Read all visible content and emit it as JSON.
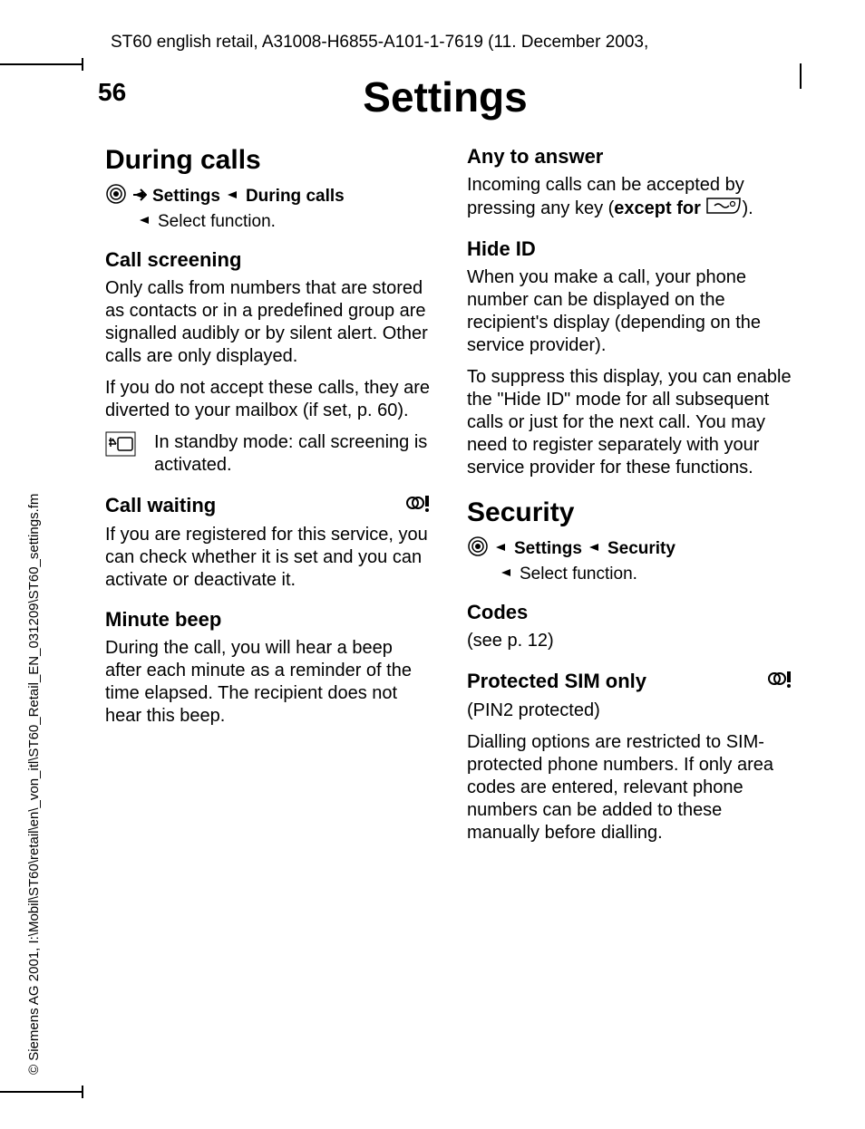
{
  "header_text": "ST60 english retail, A31008-H6855-A101-1-7619 (11. December 2003,",
  "page_number": "56",
  "page_title": "Settings",
  "sidebar": "© Siemens AG 2001, I:\\Mobil\\ST60\\retail\\en\\_von_itl\\ST60_Retail_EN_031209\\ST60_settings.fm",
  "left": {
    "section1_title": "During calls",
    "nav1_a": "Settings",
    "nav1_b": "During calls",
    "nav1_c": "Select function.",
    "sub1": "Call screening",
    "p1": "Only calls from numbers that are stored as contacts or in a predefined group are signalled audibly or by silent alert. Other calls are only displayed.",
    "p2": "If you do not accept these calls, they are diverted to your mailbox (if set, p. 60).",
    "icon_text": "In standby mode: call screening is activated.",
    "sub2": "Call waiting",
    "p3": "If you are registered for this service, you can check whether it is set and you can activate or deactivate it.",
    "sub3": "Minute beep",
    "p4": "During the call, you will hear a beep after each minute as a reminder of the time elapsed. The recipient does not hear this beep."
  },
  "right": {
    "sub1": "Any to answer",
    "p1a": "Incoming calls can be accepted by pressing any key (",
    "p1b": "except for ",
    "p1c": ").",
    "sub2": "Hide ID",
    "p2": "When you make a call, your phone number can be displayed on the recipient's display (depending on the service provider).",
    "p3": "To suppress this display, you can enable the \"Hide ID\" mode for all subsequent calls or just for the next call. You may need to register separately with your service provider for these functions.",
    "section2_title": "Security",
    "nav2_a": "Settings",
    "nav2_b": "Security",
    "nav2_c": "Select function.",
    "sub3": "Codes",
    "p4": "(see p. 12)",
    "sub4": "Protected SIM only",
    "p5": "(PIN2 protected)",
    "p6": "Dialling options are restricted to SIM-protected phone numbers. If only area codes are entered, relevant phone numbers can be added to these manually before dialling."
  }
}
